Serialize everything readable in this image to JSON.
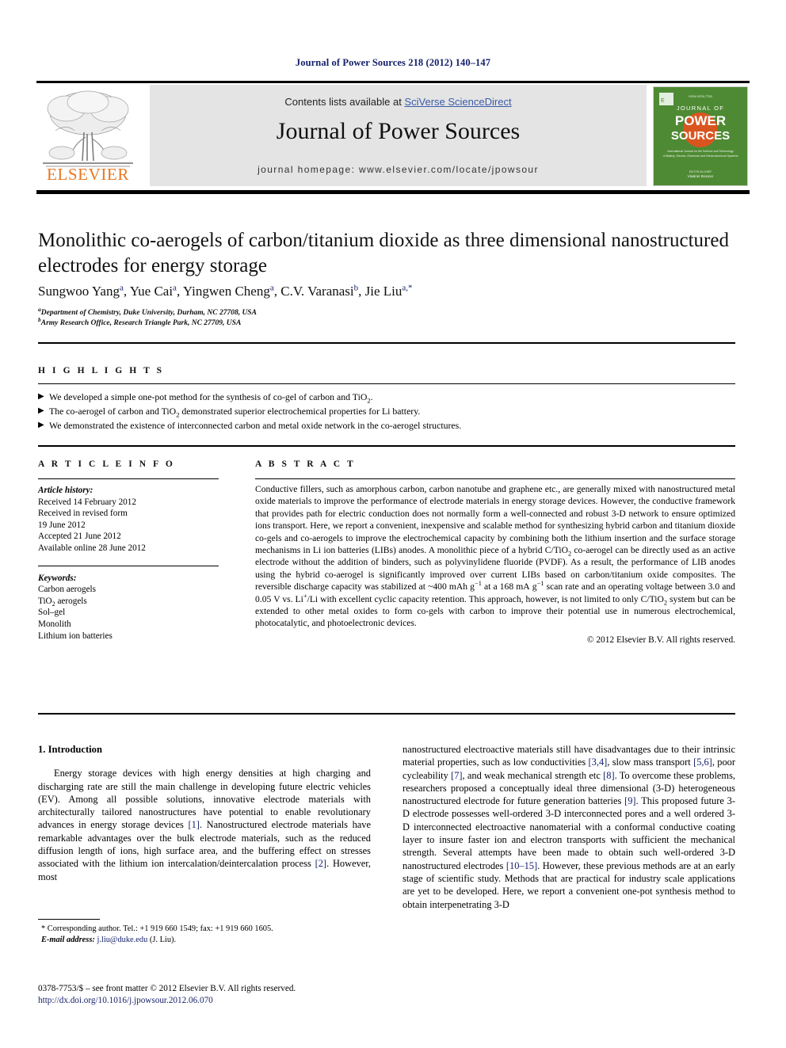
{
  "running_head": "Journal of Power Sources 218 (2012) 140–147",
  "banner": {
    "publisher_name": "ELSEVIER",
    "contents_prefix": "Contents lists available at ",
    "contents_link": "SciVerse ScienceDirect",
    "journal_name": "Journal of Power Sources",
    "homepage": "journal homepage: www.elsevier.com/locate/jpowsour",
    "cover": {
      "line1": "JOURNAL OF",
      "line2": "POWER",
      "line3": "SOURCES",
      "subtitle": "International Journal on the Science and Technology of Battery, Electric, Electronic and Electrochemical Systems",
      "editor_label": "EDITOR-IN-CHIEF",
      "editor_name": "Vladimir Brunner",
      "bg_color": "#4e8a33",
      "accent_color": "#d9551f"
    }
  },
  "article": {
    "title": "Monolithic co-aerogels of carbon/titanium dioxide as three dimensional nanostructured electrodes for energy storage",
    "authors": [
      {
        "name": "Sungwoo Yang",
        "sup": "a"
      },
      {
        "name": "Yue Cai",
        "sup": "a"
      },
      {
        "name": "Yingwen Cheng",
        "sup": "a"
      },
      {
        "name": "C.V. Varanasi",
        "sup": "b"
      },
      {
        "name": "Jie Liu",
        "sup": "a,*"
      }
    ],
    "affiliations": [
      {
        "sup": "a",
        "text": "Department of Chemistry, Duke University, Durham, NC 27708, USA"
      },
      {
        "sup": "b",
        "text": "Army Research Office, Research Triangle Park, NC 27709, USA"
      }
    ]
  },
  "highlights": {
    "heading": "H I G H L I G H T S",
    "bullet_glyph": "▶",
    "items": [
      "We developed a simple one-pot method for the synthesis of co-gel of carbon and TiO2.",
      "The co-aerogel of carbon and TiO2 demonstrated superior electrochemical properties for Li battery.",
      "We demonstrated the existence of interconnected carbon and metal oxide network in the co-aerogel structures."
    ]
  },
  "article_info": {
    "heading": "A R T I C L E   I N F O",
    "history_label": "Article history:",
    "history": [
      "Received 14 February 2012",
      "Received in revised form",
      "19 June 2012",
      "Accepted 21 June 2012",
      "Available online 28 June 2012"
    ],
    "keywords_label": "Keywords:",
    "keywords": [
      "Carbon aerogels",
      "TiO2 aerogels",
      "Sol–gel",
      "Monolith",
      "Lithium ion batteries"
    ]
  },
  "abstract": {
    "heading": "A B S T R A C T",
    "text": "Conductive fillers, such as amorphous carbon, carbon nanotube and graphene etc., are generally mixed with nanostructured metal oxide materials to improve the performance of electrode materials in energy storage devices. However, the conductive framework that provides path for electric conduction does not normally form a well-connected and robust 3-D network to ensure optimized ions transport. Here, we report a convenient, inexpensive and scalable method for synthesizing hybrid carbon and titanium dioxide co-gels and co-aerogels to improve the electrochemical capacity by combining both the lithium insertion and the surface storage mechanisms in Li ion batteries (LIBs) anodes. A monolithic piece of a hybrid C/TiO2 co-aerogel can be directly used as an active electrode without the addition of binders, such as polyvinylidene fluoride (PVDF). As a result, the performance of LIB anodes using the hybrid co-aerogel is significantly improved over current LIBs based on carbon/titanium oxide composites. The reversible discharge capacity was stabilized at ~400 mAh g-1 at a 168 mA g-1 scan rate and an operating voltage between 3.0 and 0.05 V vs. Li+/Li with excellent cyclic capacity retention. This approach, however, is not limited to only C/TiO2 system but can be extended to other metal oxides to form co-gels with carbon to improve their potential use in numerous electrochemical, photocatalytic, and photoelectronic devices.",
    "copyright": "© 2012 Elsevier B.V. All rights reserved."
  },
  "introduction": {
    "heading": "1. Introduction",
    "left_paragraph": "Energy storage devices with high energy densities at high charging and discharging rate are still the main challenge in developing future electric vehicles (EV). Among all possible solutions, innovative electrode materials with architecturally tailored nanostructures have potential to enable revolutionary advances in energy storage devices [1]. Nanostructured electrode materials have remarkable advantages over the bulk electrode materials, such as the reduced diffusion length of ions, high surface area, and the buffering effect on stresses associated with the lithium ion intercalation/deintercalation process [2]. However, most",
    "right_paragraph": "nanostructured electroactive materials still have disadvantages due to their intrinsic material properties, such as low conductivities [3,4], slow mass transport [5,6], poor cycleability [7], and weak mechanical strength etc [8]. To overcome these problems, researchers proposed a conceptually ideal three dimensional (3-D) heterogeneous nanostructured electrode for future generation batteries [9]. This proposed future 3-D electrode possesses well-ordered 3-D interconnected pores and a well ordered 3-D interconnected electroactive nanomaterial with a conformal conductive coating layer to insure faster ion and electron transports with sufficient the mechanical strength. Several attempts have been made to obtain such well-ordered 3-D nanostructured electrodes [10–15]. However, these previous methods are at an early stage of scientific study. Methods that are practical for industry scale applications are yet to be developed. Here, we report a convenient one-pot synthesis method to obtain interpenetrating 3-D"
  },
  "footnote": {
    "corresponding": "* Corresponding author. Tel.: +1 919 660 1549; fax: +1 919 660 1605.",
    "email_label": "E-mail address:",
    "email": "j.liu@duke.edu",
    "email_owner": "(J. Liu)."
  },
  "footer": {
    "issn_line": "0378-7753/$ – see front matter © 2012 Elsevier B.V. All rights reserved.",
    "doi": "http://dx.doi.org/10.1016/j.jpowsour.2012.06.070"
  }
}
